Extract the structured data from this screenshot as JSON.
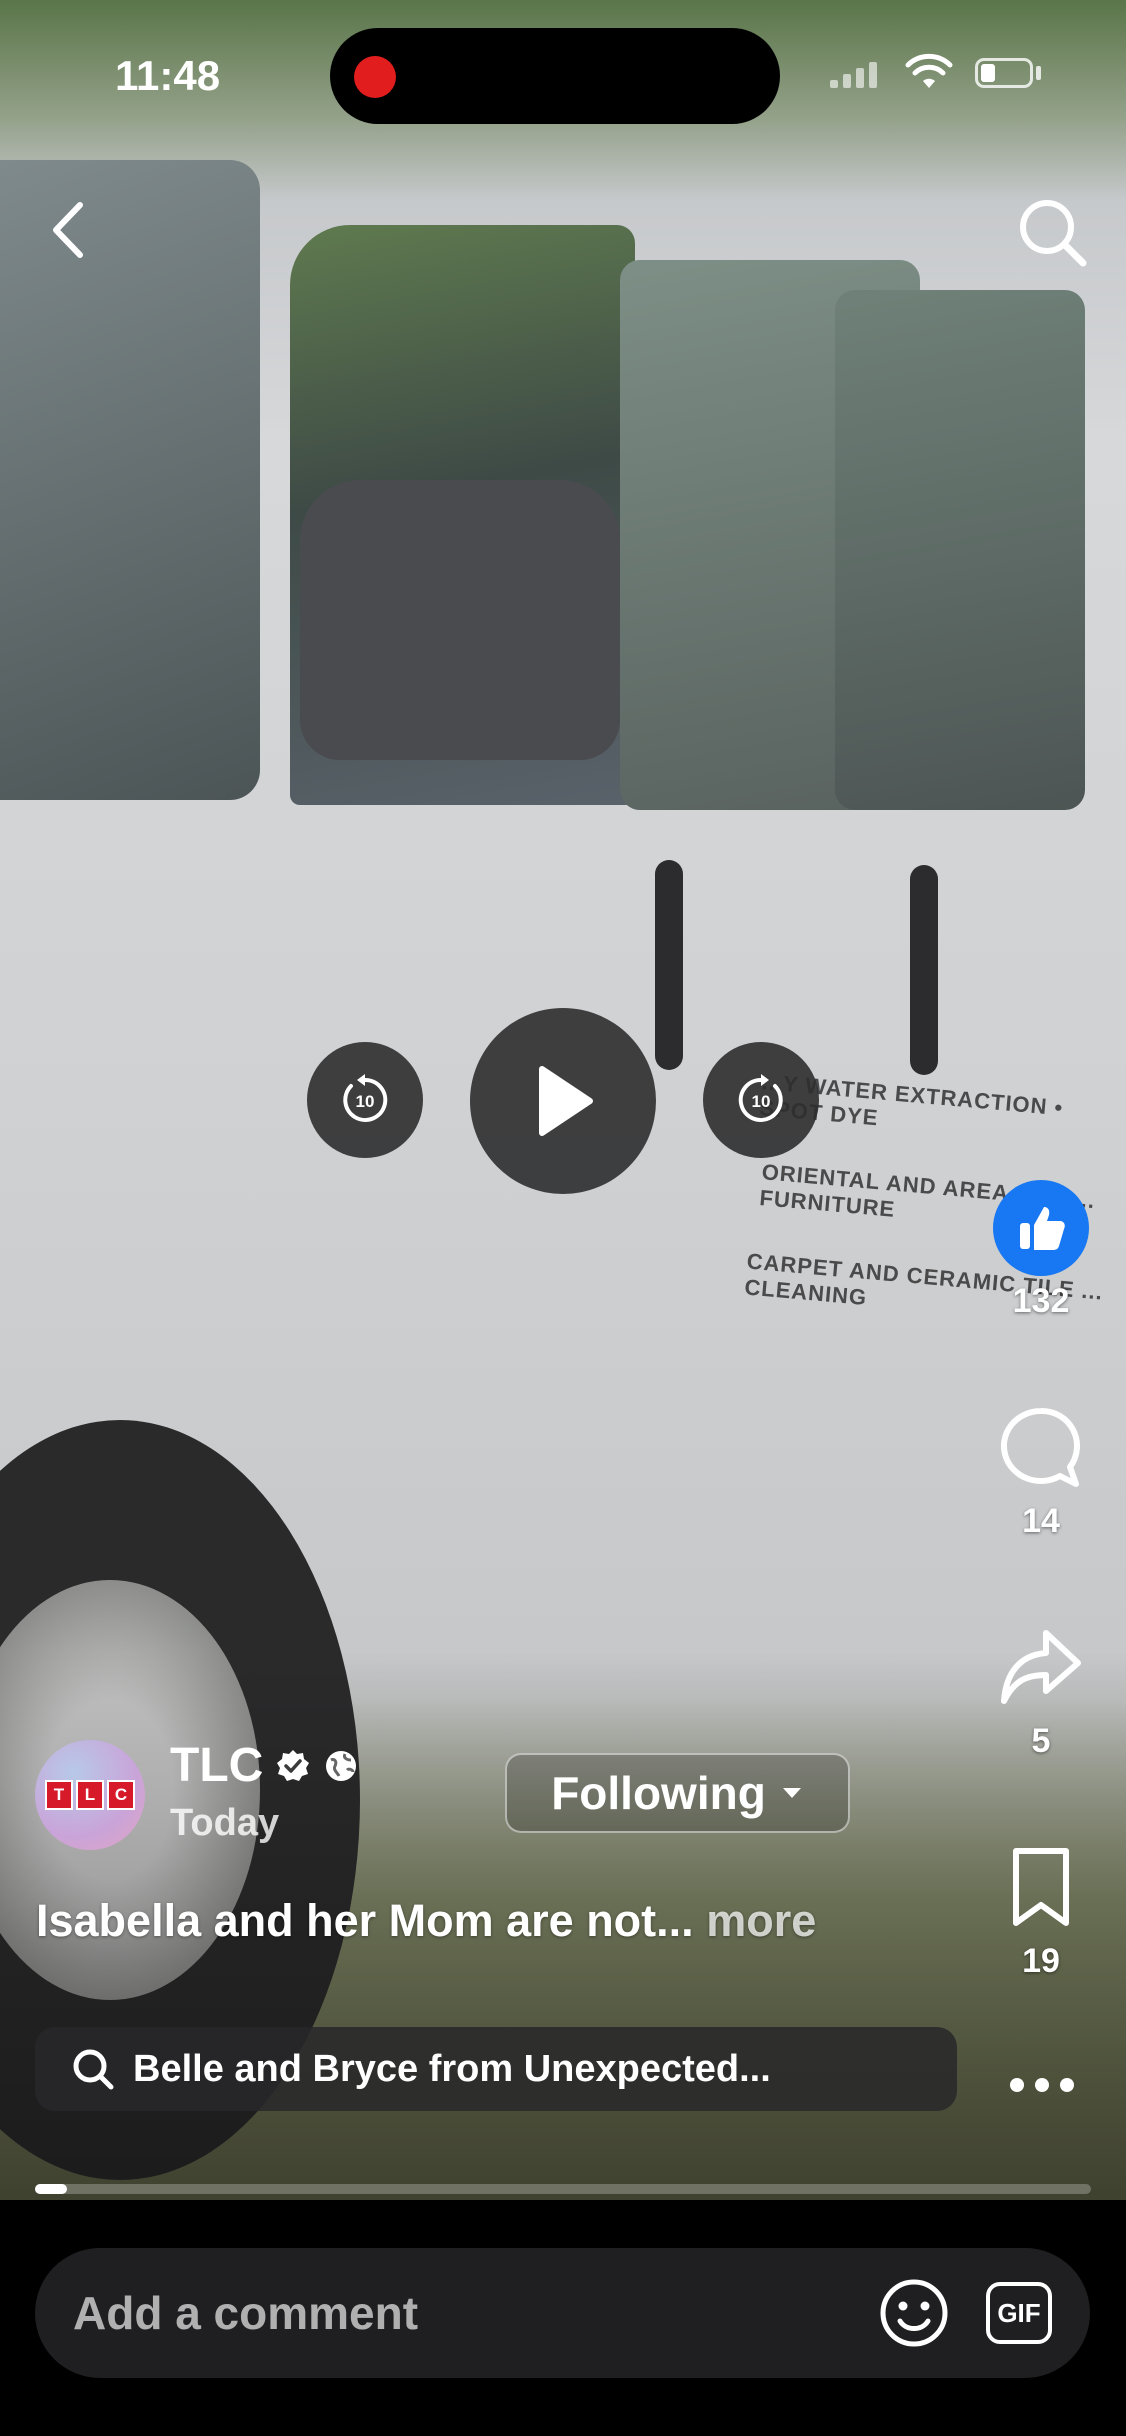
{
  "status_bar": {
    "time": "11:48"
  },
  "video": {
    "decal_lines": [
      "...Y WATER EXTRACTION • SPOT DYE",
      "ORIENTAL AND AREA RUG ... FURNITURE",
      "CARPET AND CERAMIC TILE ... CLEANING"
    ],
    "replay_seconds": "10",
    "forward_seconds": "10",
    "progress": 0.03
  },
  "actions": {
    "likes": "132",
    "comments": "14",
    "shares": "5",
    "saves": "19"
  },
  "post": {
    "page_name": "TLC",
    "avatar_text": [
      "T",
      "L",
      "C"
    ],
    "time": "Today",
    "follow_label": "Following",
    "caption": "Isabella and her Mom are not...",
    "caption_more": "more",
    "related_search": "Belle and Bryce from Unexpected..."
  },
  "comment_bar": {
    "placeholder": "Add a comment",
    "gif_label": "GIF"
  },
  "colors": {
    "like_blue": "#1877f2",
    "record_red": "#e11d1d",
    "logo_red": "#d71a2a"
  }
}
